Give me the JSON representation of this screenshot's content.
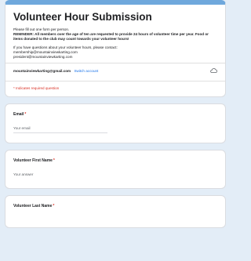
{
  "form": {
    "title": "Volunteer Hour Submission",
    "desc_line1": "Please fill out one form per person.",
    "reminder": "REMINDER: All members over the age of ten are requested to provide 24 hours of volunteer time per year. Food or items donated to the club may count towards your volunteer hours!",
    "contact_intro": "If you have questions about your volunteer hours, please contact:",
    "contact_email_1": "membership@mountainviewkarting.com",
    "contact_email_2": "president@mountainviewkarting.com",
    "account_email": "mountainviewkarting@gmail.com",
    "switch_account": "Switch account",
    "required_note": "* Indicates required question"
  },
  "questions": [
    {
      "label": "Email",
      "required": "*",
      "placeholder": "Your email"
    },
    {
      "label": "Volunteer First Name",
      "required": "*",
      "placeholder": "Your answer"
    },
    {
      "label": "Volunteer Last Name",
      "required": "*",
      "placeholder": ""
    }
  ],
  "colors": {
    "accent": "#6fa8dc",
    "required": "#d93025",
    "link": "#1a73e8",
    "background": "#e3edf7"
  },
  "icons": {
    "account_status": "cloud-icon"
  }
}
